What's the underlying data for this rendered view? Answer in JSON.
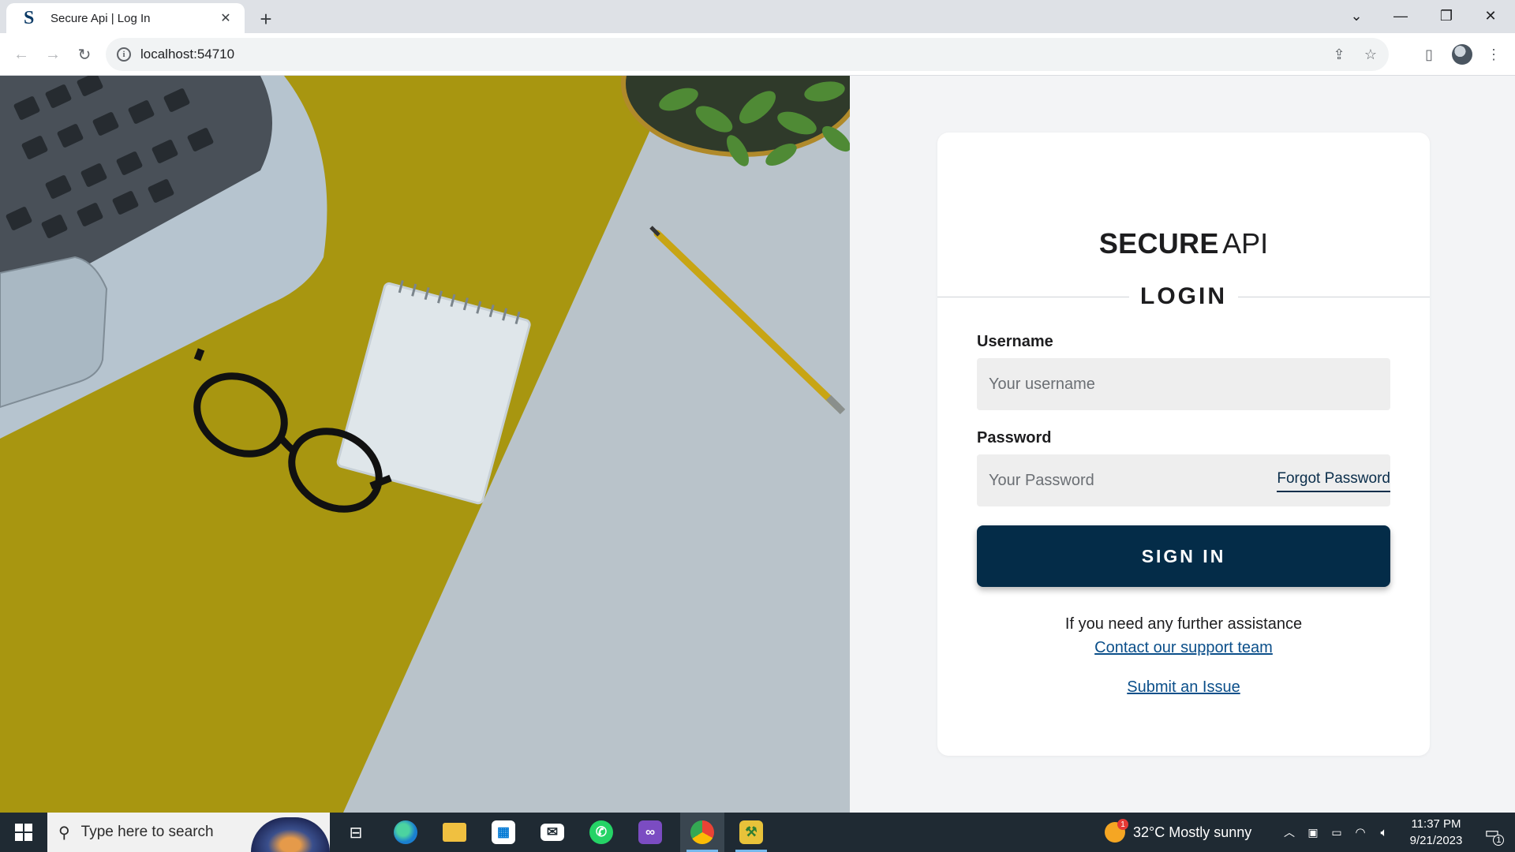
{
  "browser": {
    "tab_title": "Secure Api | Log In",
    "tab_favicon": "S",
    "url": "localhost:54710"
  },
  "brand": {
    "strong": "SECURE",
    "light": "API"
  },
  "login": {
    "title": "LOGIN",
    "username_label": "Username",
    "username_placeholder": "Your username",
    "password_label": "Password",
    "password_placeholder": "Your Password",
    "forgot_label": "Forgot Password",
    "signin_label": "SIGN IN",
    "assist_text": "If you need any further assistance",
    "support_link": "Contact our support team",
    "issue_link": "Submit an Issue"
  },
  "colors": {
    "primary": "#042c48",
    "link": "#0b4f8a",
    "hero_yellow": "#a89610",
    "hero_gray": "#b9c3ca"
  },
  "taskbar": {
    "search_placeholder": "Type here to search",
    "weather": "32°C  Mostly sunny",
    "weather_badge": "1",
    "time": "11:37 PM",
    "date": "9/21/2023",
    "notification_count": "1",
    "apps": [
      "start-icon",
      "task-view-icon",
      "edge-icon",
      "file-explorer-icon",
      "store-icon",
      "mail-icon",
      "whatsapp-icon",
      "visual-studio-icon",
      "chrome-icon",
      "app-icon"
    ]
  }
}
